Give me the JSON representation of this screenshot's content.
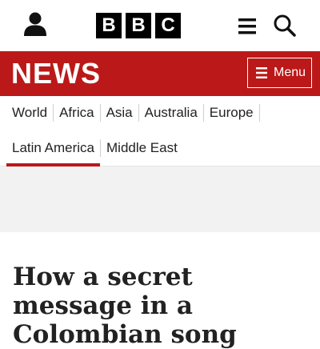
{
  "header": {
    "account_icon": "account-icon",
    "logo_letters": [
      "B",
      "B",
      "C"
    ],
    "menu_icon": "hamburger-menu-icon",
    "search_icon": "search-icon"
  },
  "news_bar": {
    "title": "NEWS",
    "menu_label": "Menu",
    "color": "#bb1919"
  },
  "nav": {
    "row1": [
      "World",
      "Africa",
      "Asia",
      "Australia",
      "Europe"
    ],
    "row2": [
      "Latin America",
      "Middle East"
    ],
    "active": "Latin America"
  },
  "article": {
    "headline": "How a secret message in a Colombian song"
  }
}
